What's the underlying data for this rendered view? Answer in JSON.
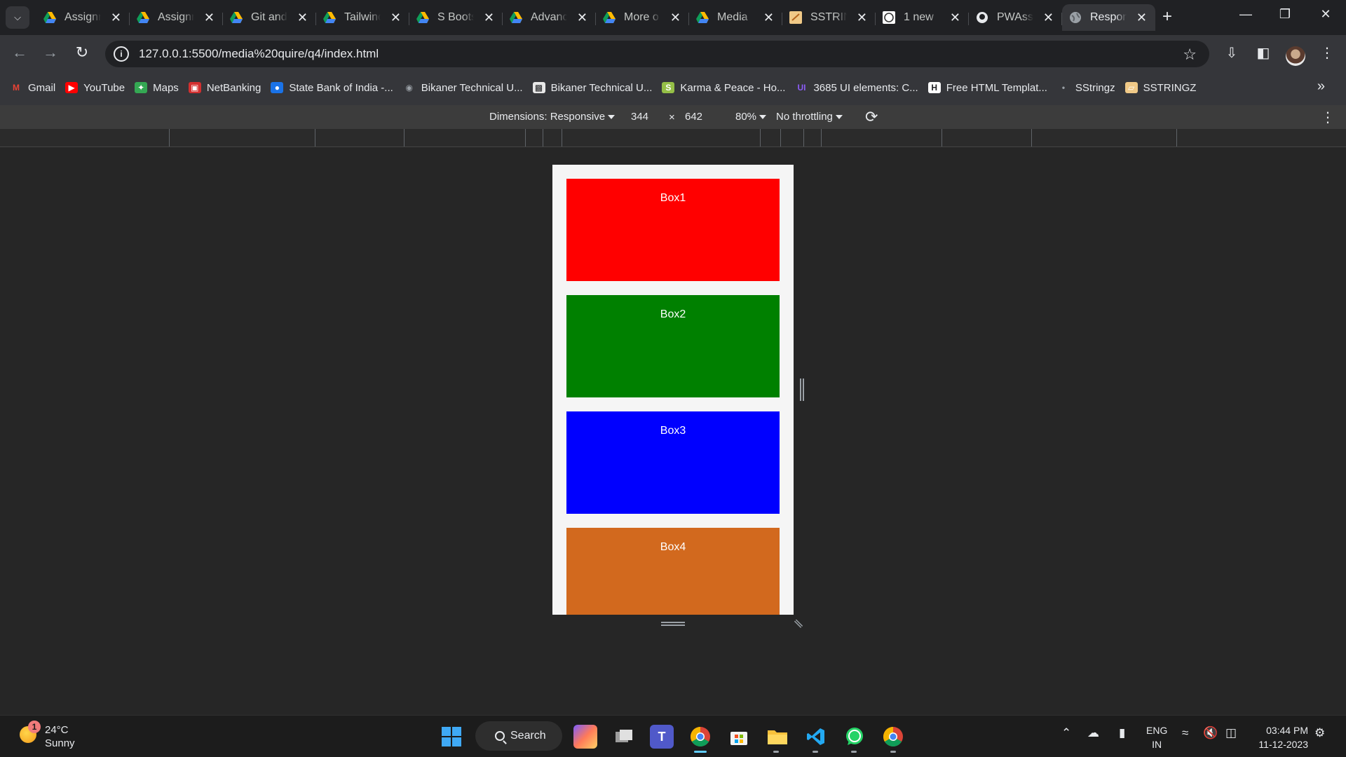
{
  "tabs": [
    {
      "title": "Assignm",
      "icon": "google-drive-icon"
    },
    {
      "title": "Assignm",
      "icon": "google-drive-icon"
    },
    {
      "title": "Git and",
      "icon": "google-drive-icon"
    },
    {
      "title": "Tailwind",
      "icon": "google-drive-icon"
    },
    {
      "title": "S Boots",
      "icon": "google-drive-icon"
    },
    {
      "title": "Advanc",
      "icon": "google-drive-icon"
    },
    {
      "title": "More o",
      "icon": "google-drive-icon"
    },
    {
      "title": "Media",
      "icon": "google-drive-icon"
    },
    {
      "title": "SSTRIN",
      "icon": "sstringz-icon"
    },
    {
      "title": "1 new",
      "icon": "wordpress-icon"
    },
    {
      "title": "PWAss",
      "icon": "github-icon"
    },
    {
      "title": "Respon",
      "icon": "globe-icon",
      "active": true
    }
  ],
  "address": {
    "url": "127.0.0.1:5500/media%20quire/q4/index.html"
  },
  "bookmarks": [
    {
      "label": "Gmail",
      "icon": "gmail-icon",
      "color": "#ea4335"
    },
    {
      "label": "YouTube",
      "icon": "youtube-icon",
      "color": "#ff0000"
    },
    {
      "label": "Maps",
      "icon": "maps-icon",
      "color": "#34a853"
    },
    {
      "label": "NetBanking",
      "icon": "hdfc-icon",
      "color": "#d32f2f"
    },
    {
      "label": "State Bank of India -...",
      "icon": "sbi-icon",
      "color": "#1a73e8"
    },
    {
      "label": "Bikaner Technical U...",
      "icon": "globe-icon",
      "color": "#9aa0a6"
    },
    {
      "label": "Bikaner Technical U...",
      "icon": "university-icon",
      "color": "#e8e8e8"
    },
    {
      "label": "Karma & Peace - Ho...",
      "icon": "shopify-icon",
      "color": "#95bf47"
    },
    {
      "label": "3685 UI elements: C...",
      "icon": "uiverse-icon",
      "color": "#8b5cf6"
    },
    {
      "label": "Free HTML Templat...",
      "icon": "h-icon",
      "color": "#ffffff"
    },
    {
      "label": "SStringz",
      "icon": "dot-icon",
      "color": "#9aa0a6"
    },
    {
      "label": "SSTRINGZ",
      "icon": "sstringz-icon",
      "color": "#f0c987"
    }
  ],
  "devtools": {
    "dimensions_label": "Dimensions: Responsive",
    "width": "344",
    "times": "×",
    "height": "642",
    "zoom": "80%",
    "throttling": "No throttling"
  },
  "page": {
    "boxes": [
      {
        "label": "Box1",
        "color": "#ff0000"
      },
      {
        "label": "Box2",
        "color": "#008000"
      },
      {
        "label": "Box3",
        "color": "#0000ff"
      },
      {
        "label": "Box4",
        "color": "#d2691e"
      }
    ]
  },
  "taskbar": {
    "weather_badge": "1",
    "temperature": "24°C",
    "condition": "Sunny",
    "search_label": "Search",
    "lang_top": "ENG",
    "lang_bottom": "IN",
    "time": "03:44 PM",
    "date": "11-12-2023"
  }
}
